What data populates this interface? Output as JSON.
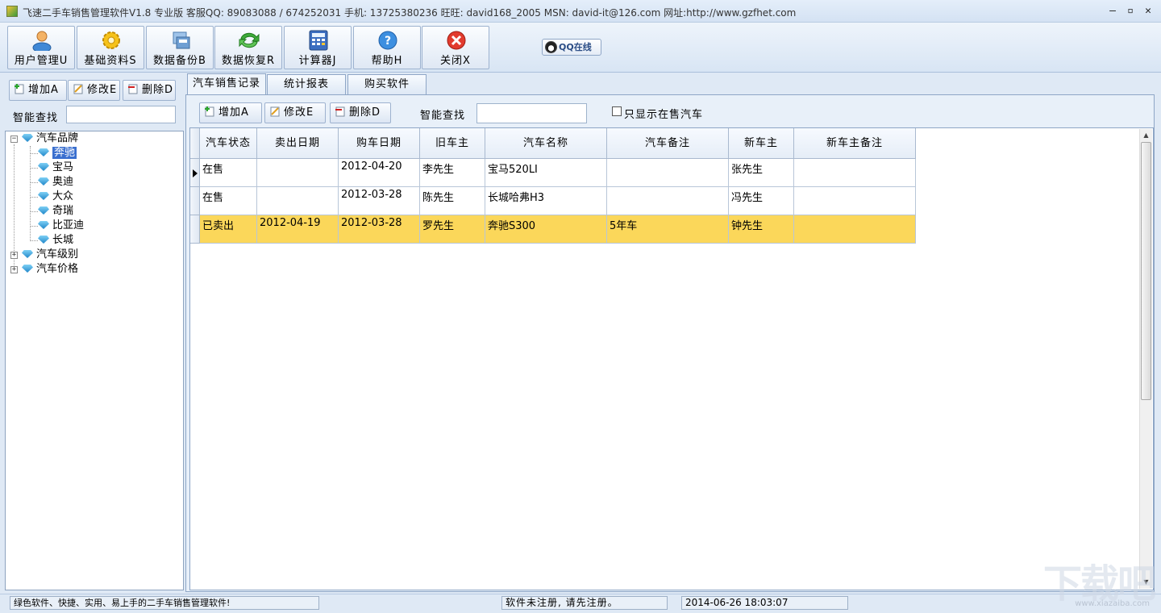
{
  "window": {
    "title": "飞速二手车销售管理软件V1.8 专业版 客服QQ: 89083088 / 674252031 手机: 13725380236 旺旺: david168_2005 MSN: david-it@126.com   网址:http://www.gzfhet.com",
    "min": "–",
    "max": "▫",
    "close": "✕"
  },
  "toolbar": {
    "buttons": [
      {
        "label": "用户管理U",
        "icon": "user-icon"
      },
      {
        "label": "基础资料S",
        "icon": "gear-icon"
      },
      {
        "label": "数据备份B",
        "icon": "backup-icon"
      },
      {
        "label": "数据恢复R",
        "icon": "restore-icon"
      },
      {
        "label": "计算器J",
        "icon": "calculator-icon"
      },
      {
        "label": "帮助H",
        "icon": "help-icon"
      },
      {
        "label": "关闭X",
        "icon": "close-icon"
      }
    ],
    "qq": "QQ在线"
  },
  "left": {
    "add": "增加A",
    "edit": "修改E",
    "delete": "删除D",
    "search_label": "智能查找",
    "search_value": "",
    "tree": {
      "brand": "汽车品牌",
      "brands": [
        "奔驰",
        "宝马",
        "奥迪",
        "大众",
        "奇瑞",
        "比亚迪",
        "长城"
      ],
      "level": "汽车级别",
      "price": "汽车价格",
      "selected": "奔驰"
    }
  },
  "tabs": [
    "汽车销售记录",
    "统计报表",
    "购买软件"
  ],
  "main": {
    "add": "增加A",
    "edit": "修改E",
    "delete": "删除D",
    "search_label": "智能查找",
    "search_value": "",
    "only_on_sale": "只显示在售汽车",
    "only_on_sale_checked": false,
    "columns": [
      "汽车状态",
      "卖出日期",
      "购车日期",
      "旧车主",
      "汽车名称",
      "汽车备注",
      "新车主",
      "新车主备注"
    ],
    "rows": [
      [
        "在售",
        "",
        "2012-04-20",
        "李先生",
        "宝马520LI",
        "",
        "张先生",
        ""
      ],
      [
        "在售",
        "",
        "2012-03-28",
        "陈先生",
        "长城哈弗H3",
        "",
        "冯先生",
        ""
      ],
      [
        "已卖出",
        "2012-04-19",
        "2012-03-28",
        "罗先生",
        "奔驰S300",
        "5年车",
        "钟先生",
        ""
      ]
    ],
    "sold_row_color": "#fbd75a"
  },
  "status": {
    "slogan": "绿色软件、快捷、实用、易上手的二手车销售管理软件!",
    "register": "软件未注册, 请先注册。",
    "datetime": "2014-06-26 18:03:07"
  },
  "watermark": {
    "brand": "下载吧",
    "site": "www.xiazaiba.com"
  }
}
